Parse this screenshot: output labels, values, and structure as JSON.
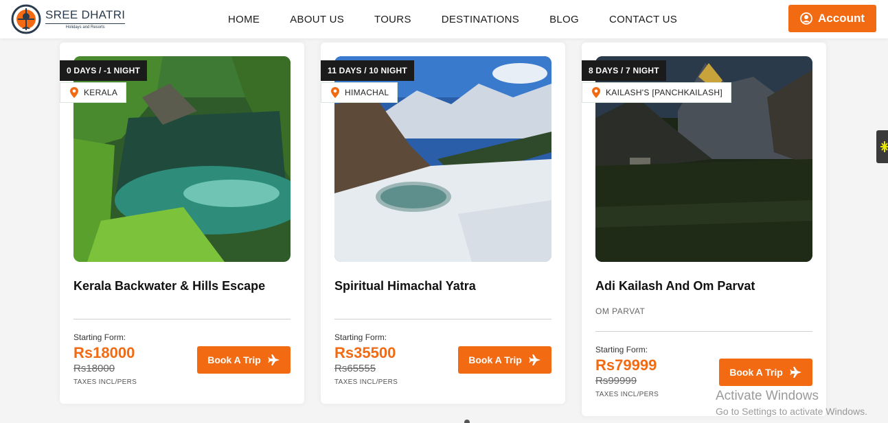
{
  "brand": {
    "title": "SREE DHATRI",
    "subtitle": "Holidays and Resorts"
  },
  "nav": [
    "HOME",
    "ABOUT US",
    "TOURS",
    "DESTINATIONS",
    "BLOG",
    "CONTACT US"
  ],
  "account_label": "Account",
  "colors": {
    "accent": "#f26a12",
    "dark_badge": "#1b1b1b"
  },
  "cards": [
    {
      "duration": "0 DAYS / -1 NIGHT",
      "location": "KERALA",
      "title": "Kerala Backwater & Hills Escape",
      "subtitle": "",
      "starting_label": "Starting Form:",
      "price": "Rs18000",
      "old_price": "Rs18000",
      "taxes": "TAXES INCL/PERS",
      "book_label": "Book A Trip"
    },
    {
      "duration": "11 DAYS / 10 NIGHT",
      "location": "HIMACHAL",
      "title": "Spiritual Himachal Yatra",
      "subtitle": "",
      "starting_label": "Starting Form:",
      "price": "Rs35500",
      "old_price": "Rs65555",
      "taxes": "TAXES INCL/PERS",
      "book_label": "Book A Trip"
    },
    {
      "duration": "8 DAYS / 7 NIGHT",
      "location": "KAILASH'S [PANCHKAILASH]",
      "title": "Adi Kailash And Om Parvat",
      "subtitle": "OM PARVAT",
      "starting_label": "Starting Form:",
      "price": "Rs79999",
      "old_price": "Rs99999",
      "taxes": "TAXES INCL/PERS",
      "book_label": "Book A Trip"
    }
  ],
  "watermark": {
    "line1": "Activate Windows",
    "line2": "Go to Settings to activate Windows."
  },
  "icons": {
    "account": "user-circle-icon",
    "location": "map-pin-icon",
    "book": "airplane-icon"
  }
}
